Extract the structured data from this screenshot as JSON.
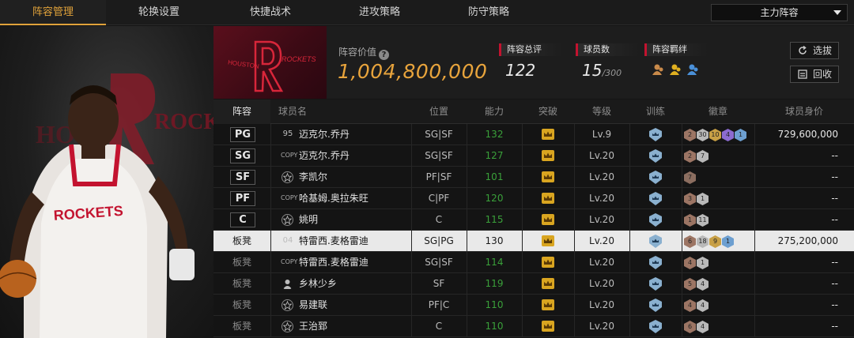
{
  "tabs": [
    {
      "label": "阵容管理",
      "active": true
    },
    {
      "label": "轮换设置",
      "active": false
    },
    {
      "label": "快捷战术",
      "active": false
    },
    {
      "label": "进攻策略",
      "active": false
    },
    {
      "label": "防守策略",
      "active": false
    }
  ],
  "lineup_select": {
    "value": "主力阵容"
  },
  "team": {
    "logo_text": "HOUSTON ROCKETS",
    "value_label": "阵容价值",
    "value": "1,004,800,000",
    "stats": [
      {
        "label": "阵容总评",
        "value": "122",
        "suffix": ""
      },
      {
        "label": "球员数",
        "value": "15",
        "suffix": "/300"
      },
      {
        "label": "阵容羁绊",
        "value": "",
        "suffix": ""
      }
    ],
    "buttons": {
      "pick": "选拔",
      "recycle": "回收"
    }
  },
  "table": {
    "headers": [
      "阵容",
      "球员名",
      "位置",
      "能力",
      "突破",
      "等级",
      "训练",
      "徽章",
      "球员身价"
    ],
    "rows": [
      {
        "slot": "PG",
        "bench": false,
        "tag": "95",
        "tag_type": "num",
        "name": "迈克尔.乔丹",
        "position": "SG|SF",
        "ability": "132",
        "ability_color": "green",
        "level": "Lv.9",
        "badges": [
          [
            "b-brz",
            "2"
          ],
          [
            "b-slv",
            "30"
          ],
          [
            "b-gld",
            "10"
          ],
          [
            "b-pur",
            "4"
          ],
          [
            "b-blu",
            "1"
          ]
        ],
        "price": "729,600,000"
      },
      {
        "slot": "SG",
        "bench": false,
        "tag": "COPY",
        "tag_type": "copy",
        "name": "迈克尔.乔丹",
        "position": "SG|SF",
        "ability": "127",
        "ability_color": "green",
        "level": "Lv.20",
        "badges": [
          [
            "b-brz",
            "2"
          ],
          [
            "b-slv",
            "7"
          ]
        ],
        "price": "--"
      },
      {
        "slot": "SF",
        "bench": false,
        "tag": "",
        "tag_type": "star",
        "name": "李凯尔",
        "position": "PF|SF",
        "ability": "101",
        "ability_color": "green",
        "level": "Lv.20",
        "badges": [
          [
            "b-cpy",
            "7"
          ]
        ],
        "price": "--"
      },
      {
        "slot": "PF",
        "bench": false,
        "tag": "COPY",
        "tag_type": "copy",
        "name": "哈基姆.奥拉朱旺",
        "position": "C|PF",
        "ability": "120",
        "ability_color": "green",
        "level": "Lv.20",
        "badges": [
          [
            "b-brz",
            "3"
          ],
          [
            "b-slv",
            "1"
          ]
        ],
        "price": "--"
      },
      {
        "slot": "C",
        "bench": false,
        "tag": "",
        "tag_type": "star",
        "name": "姚明",
        "position": "C",
        "ability": "115",
        "ability_color": "green",
        "level": "Lv.20",
        "badges": [
          [
            "b-brz",
            "1"
          ],
          [
            "b-slv",
            "11"
          ]
        ],
        "price": "--"
      },
      {
        "slot": "板凳",
        "bench": true,
        "selected": true,
        "tag": "04",
        "tag_type": "num",
        "name": "特雷西.麦格雷迪",
        "position": "SG|PG",
        "ability": "130",
        "ability_color": "normal",
        "level": "Lv.20",
        "badges": [
          [
            "b-brz",
            "6"
          ],
          [
            "b-slv",
            "18"
          ],
          [
            "b-gld",
            "9"
          ],
          [
            "b-blu",
            "1"
          ]
        ],
        "price": "275,200,000"
      },
      {
        "slot": "板凳",
        "bench": true,
        "tag": "COPY",
        "tag_type": "copy",
        "name": "特雷西.麦格雷迪",
        "position": "SG|SF",
        "ability": "114",
        "ability_color": "green",
        "level": "Lv.20",
        "badges": [
          [
            "b-brz",
            "4"
          ],
          [
            "b-slv",
            "1"
          ]
        ],
        "price": "--"
      },
      {
        "slot": "板凳",
        "bench": true,
        "tag": "",
        "tag_type": "person",
        "name": "乡林少乡",
        "position": "SF",
        "ability": "119",
        "ability_color": "green",
        "level": "Lv.20",
        "badges": [
          [
            "b-brz",
            "5"
          ],
          [
            "b-slv",
            "4"
          ]
        ],
        "price": "--"
      },
      {
        "slot": "板凳",
        "bench": true,
        "tag": "",
        "tag_type": "star",
        "name": "易建联",
        "position": "PF|C",
        "ability": "110",
        "ability_color": "green",
        "level": "Lv.20",
        "badges": [
          [
            "b-brz",
            "4"
          ],
          [
            "b-slv",
            "4"
          ]
        ],
        "price": "--"
      },
      {
        "slot": "板凳",
        "bench": true,
        "tag": "",
        "tag_type": "star",
        "name": "王治郅",
        "position": "C",
        "ability": "110",
        "ability_color": "green",
        "level": "Lv.20",
        "badges": [
          [
            "b-brz",
            "6"
          ],
          [
            "b-slv",
            "4"
          ]
        ],
        "price": "--"
      }
    ]
  },
  "colors": {
    "accent": "#e0a23a",
    "value": "#e8a43c",
    "team_red": "#c3132f",
    "green": "#3aa03a"
  },
  "icons": [
    "help-icon",
    "chevron-down-icon",
    "refresh-icon",
    "recycle-icon",
    "crown-icon",
    "training-icon",
    "badge-icon",
    "star-icon",
    "person-icon",
    "bond-icon"
  ]
}
